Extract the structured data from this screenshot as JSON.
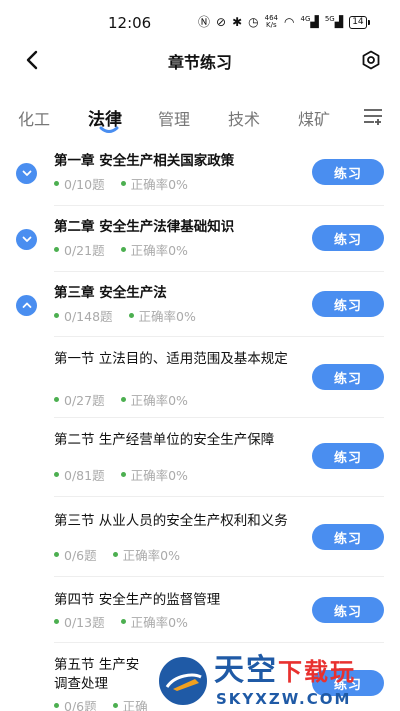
{
  "status_bar": {
    "time": "12:06",
    "net_rate_top": "464",
    "net_rate_bottom": "K/s",
    "signal_1": "4G",
    "signal_2": "5G",
    "battery": "14"
  },
  "header": {
    "title": "章节练习"
  },
  "tabs": [
    {
      "label": "化工"
    },
    {
      "label": "法律"
    },
    {
      "label": "管理"
    },
    {
      "label": "技术"
    },
    {
      "label": "煤矿"
    }
  ],
  "items": [
    {
      "title": "第一章 安全生产相关国家政策",
      "progress": "0/10题",
      "accuracy": "正确率0%",
      "button": "练习"
    },
    {
      "title": "第二章 安全生产法律基础知识",
      "progress": "0/21题",
      "accuracy": "正确率0%",
      "button": "练习"
    },
    {
      "title": "第三章 安全生产法",
      "progress": "0/148题",
      "accuracy": "正确率0%",
      "button": "练习"
    },
    {
      "title": "第一节 立法目的、适用范围及基本规定",
      "progress": "0/27题",
      "accuracy": "正确率0%",
      "button": "练习"
    },
    {
      "title": "第二节 生产经营单位的安全生产保障",
      "progress": "0/81题",
      "accuracy": "正确率0%",
      "button": "练习"
    },
    {
      "title": "第三节 从业人员的安全生产权利和义务",
      "progress": "0/6题",
      "accuracy": "正确率0%",
      "button": "练习"
    },
    {
      "title": "第四节 安全生产的监督管理",
      "progress": "0/13题",
      "accuracy": "正确率0%",
      "button": "练习"
    },
    {
      "title": "第五节 生产安",
      "title_line2": "调查处理",
      "progress": "0/6题",
      "accuracy": "正确",
      "button": "练习"
    }
  ],
  "watermark": {
    "main_blue": "天空",
    "main_red": "下载玩",
    "sub": "SKYXZW.COM"
  },
  "colors": {
    "accent": "#4a8ef0",
    "dot": "#4caf50",
    "watermark_blue": "#1f5aa6",
    "watermark_red": "#e8312f"
  }
}
